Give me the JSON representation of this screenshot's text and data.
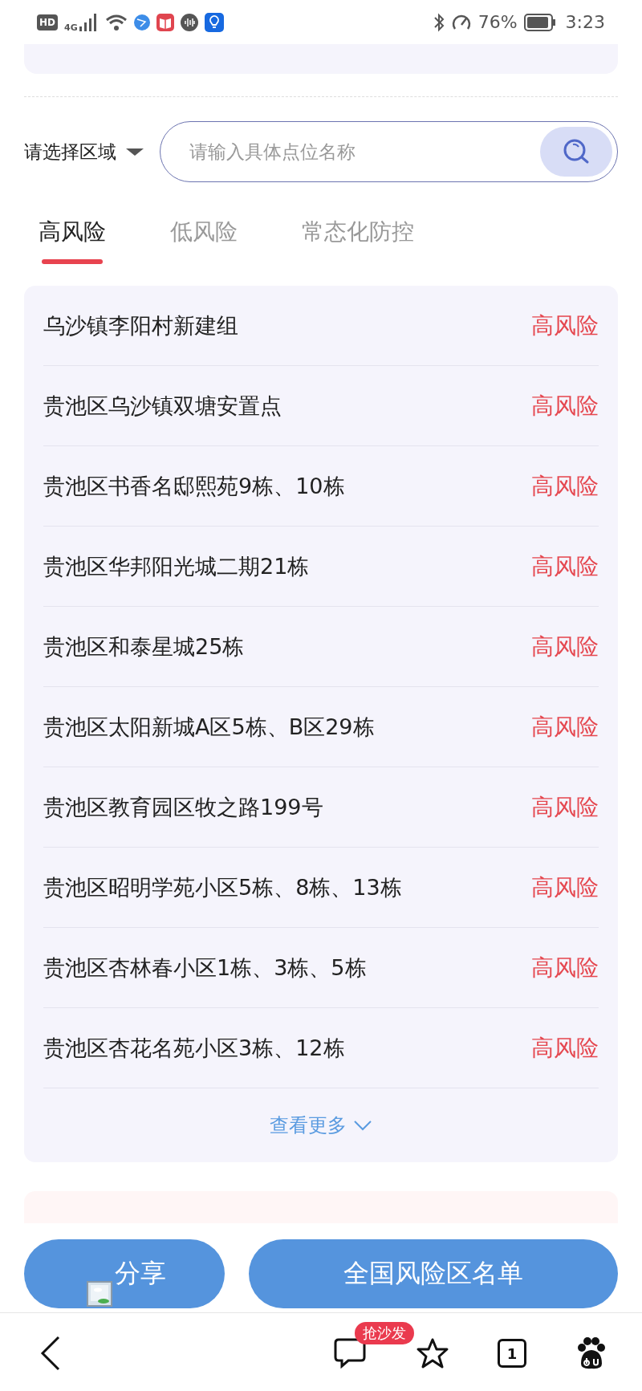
{
  "status_bar": {
    "hd_badge": "HD",
    "network": "4G",
    "battery": "76%",
    "time": "3:23"
  },
  "region_select": {
    "label": "请选择区域"
  },
  "search": {
    "placeholder": "请输入具体点位名称"
  },
  "tabs": [
    {
      "label": "高风险",
      "selected": true
    },
    {
      "label": "低风险",
      "selected": false
    },
    {
      "label": "常态化防控",
      "selected": false
    }
  ],
  "locations": [
    {
      "name": "乌沙镇李阳村新建组",
      "risk": "高风险"
    },
    {
      "name": "贵池区乌沙镇双塘安置点",
      "risk": "高风险"
    },
    {
      "name": "贵池区书香名邸熙苑9栋、10栋",
      "risk": "高风险"
    },
    {
      "name": "贵池区华邦阳光城二期21栋",
      "risk": "高风险"
    },
    {
      "name": "贵池区和泰星城25栋",
      "risk": "高风险"
    },
    {
      "name": "贵池区太阳新城A区5栋、B区29栋",
      "risk": "高风险"
    },
    {
      "name": "贵池区教育园区牧之路199号",
      "risk": "高风险"
    },
    {
      "name": "贵池区昭明学苑小区5栋、8栋、13栋",
      "risk": "高风险"
    },
    {
      "name": "贵池区杏林春小区1栋、3栋、5栋",
      "risk": "高风险"
    },
    {
      "name": "贵池区杏花名苑小区3栋、12栋",
      "risk": "高风险"
    }
  ],
  "more_link": "查看更多",
  "buttons": [
    {
      "label": "分享"
    },
    {
      "label": "全国风险区名单"
    }
  ],
  "bottom_nav": {
    "comment_badge": "抢沙发",
    "tab_count": "1"
  }
}
